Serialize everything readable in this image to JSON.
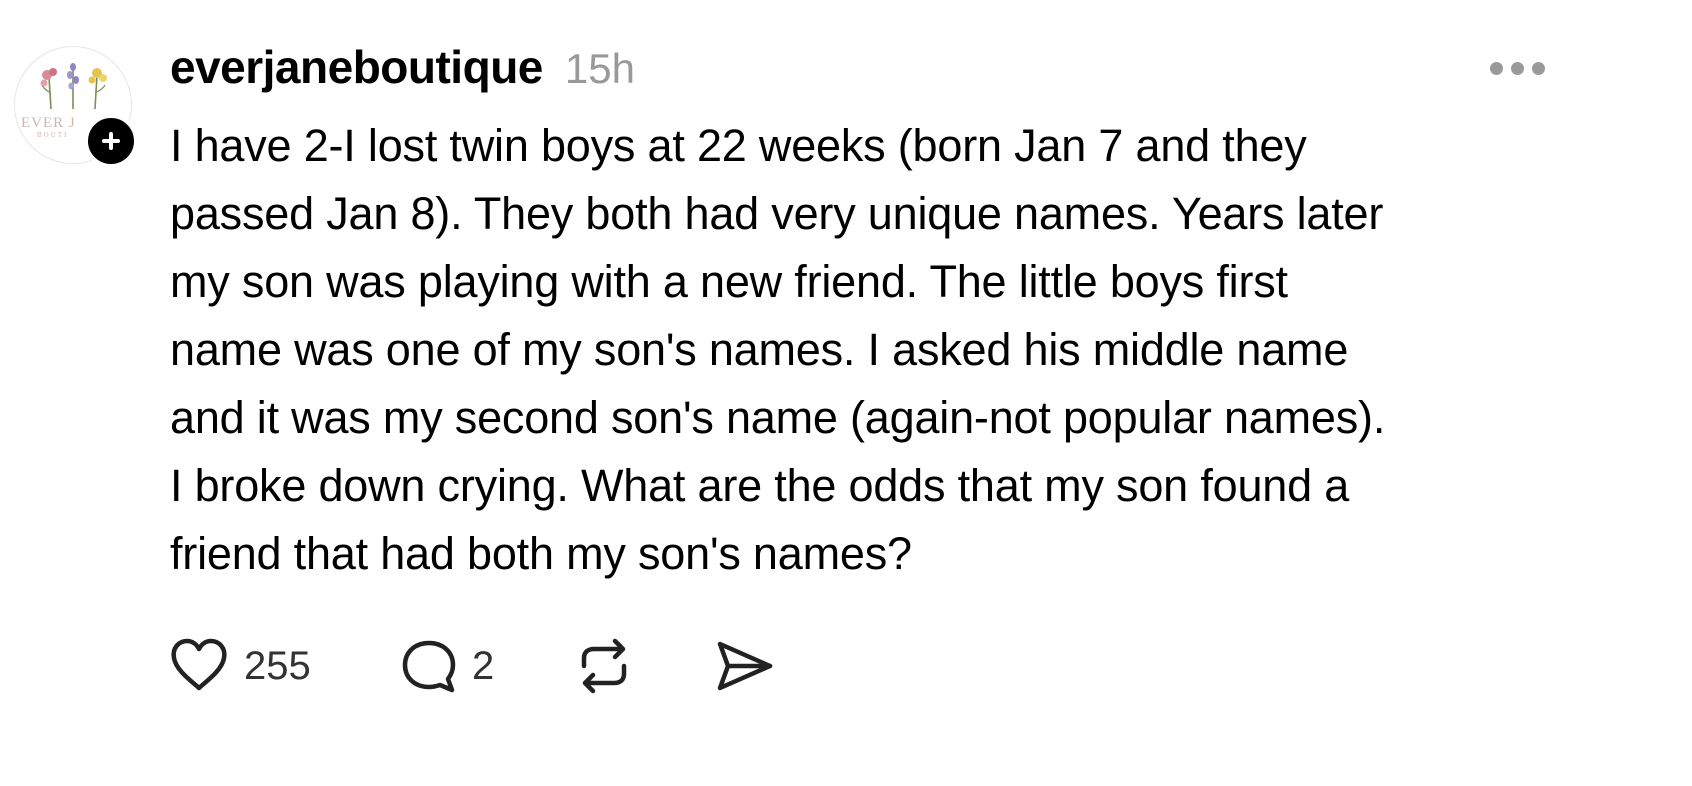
{
  "post": {
    "author": {
      "username": "everjaneboutique",
      "avatar_icon": "floral-logo-avatar",
      "avatar_text_line1": "EVER J",
      "avatar_text_line2": "BOUTI",
      "follow_icon": "plus-icon"
    },
    "timestamp": "15h",
    "more_icon": "more-dots-icon",
    "body_lines": [
      "I have 2-I lost twin boys at 22 weeks (born Jan 7 and they",
      "passed Jan 8). They both had very unique names. Years later",
      "my son was playing with a new friend. The little boys first",
      "name was one of my son's names. I asked his middle name",
      "and it was my second son's name (again-not popular names).",
      "I broke down crying. What are the odds that my son found a",
      "friend that had both my son's names?"
    ],
    "actions": {
      "like": {
        "icon": "heart-icon",
        "count": "255"
      },
      "reply": {
        "icon": "comment-icon",
        "count": "2"
      },
      "repost": {
        "icon": "repost-icon"
      },
      "share": {
        "icon": "send-icon"
      }
    },
    "colors": {
      "text": "#000000",
      "muted": "#999999",
      "badge": "#000000"
    }
  }
}
